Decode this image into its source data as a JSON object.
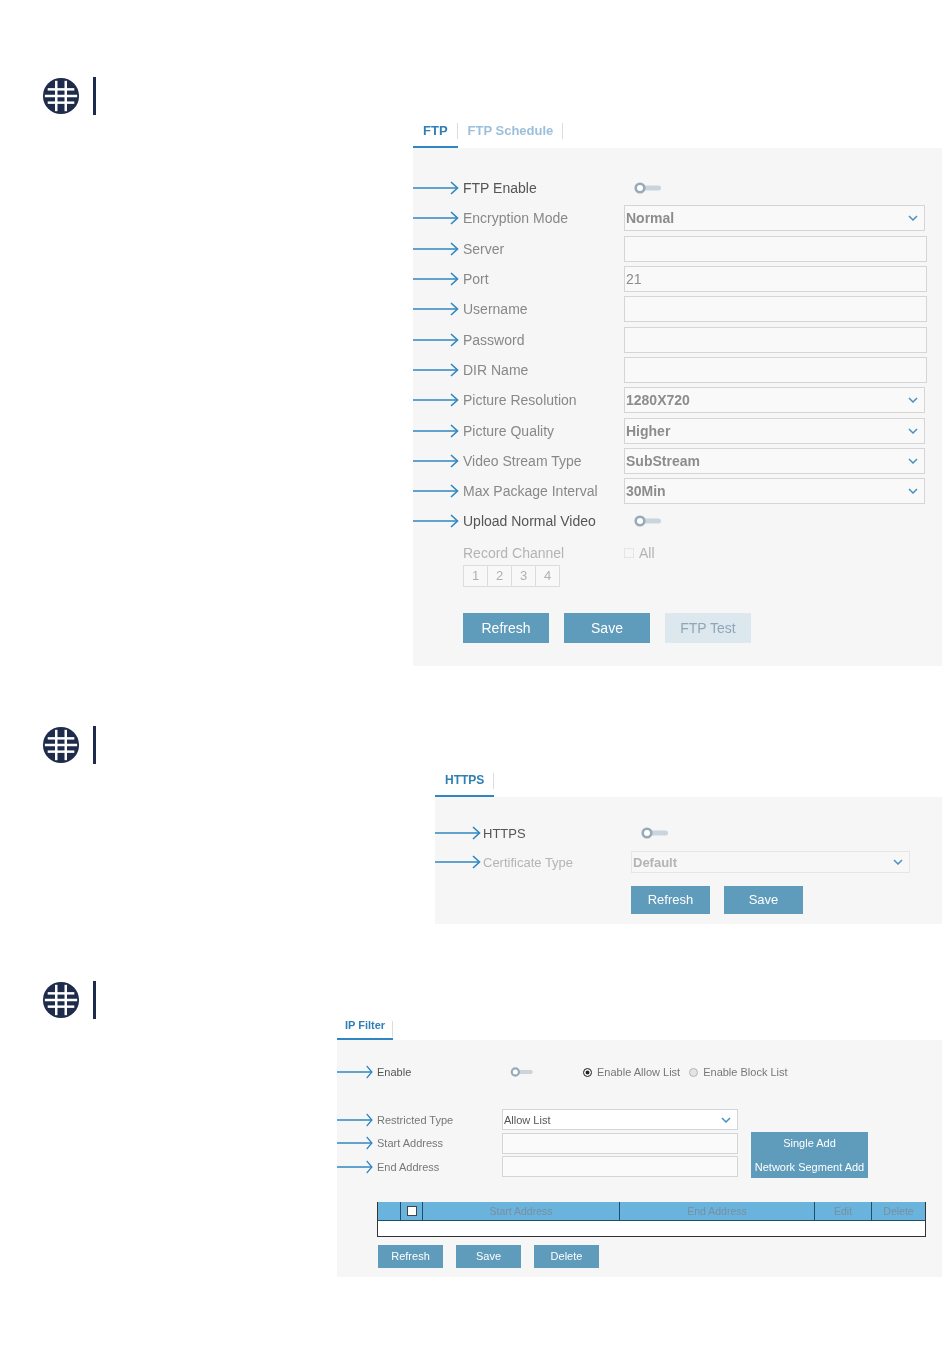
{
  "sections": [
    {
      "tabs": [
        {
          "label": "FTP",
          "selected": true
        },
        {
          "label": "FTP Schedule",
          "selected": false
        }
      ],
      "rows": [
        {
          "kind": "toggle",
          "label": "FTP Enable",
          "arrow": true,
          "disabled": false,
          "on": false
        },
        {
          "kind": "select",
          "label": "Encryption Mode",
          "arrow": true,
          "disabled": false,
          "value": "Normal"
        },
        {
          "kind": "input",
          "label": "Server",
          "arrow": true,
          "disabled": false
        },
        {
          "kind": "input",
          "label": "Port",
          "arrow": true,
          "disabled": false,
          "value": "21"
        },
        {
          "kind": "input",
          "label": "Username",
          "arrow": true,
          "disabled": false
        },
        {
          "kind": "input",
          "label": "Password",
          "arrow": true,
          "disabled": false
        },
        {
          "kind": "input",
          "label": "DIR Name",
          "arrow": true,
          "disabled": false
        },
        {
          "kind": "select",
          "label": "Picture Resolution",
          "arrow": true,
          "disabled": false,
          "value": "1280X720"
        },
        {
          "kind": "select",
          "label": "Picture Quality",
          "arrow": true,
          "disabled": false,
          "value": "Higher"
        },
        {
          "kind": "select",
          "label": "Video Stream Type",
          "arrow": true,
          "disabled": false,
          "value": "SubStream"
        },
        {
          "kind": "select",
          "label": "Max Package Interval",
          "arrow": true,
          "disabled": false,
          "value": "30Min"
        },
        {
          "kind": "toggle",
          "label": "Upload Normal Video",
          "arrow": true,
          "disabled": false,
          "on": false
        },
        {
          "kind": "channels",
          "label": "Record Channel",
          "arrow": false,
          "disabled": true,
          "checkbox_label": "All",
          "checked": false,
          "channels": [
            "1",
            "2",
            "3",
            "4"
          ]
        }
      ],
      "buttons": [
        {
          "label": "Refresh",
          "disabled": false
        },
        {
          "label": "Save",
          "disabled": false
        },
        {
          "label": "FTP Test",
          "disabled": true
        }
      ]
    },
    {
      "tabs": [
        {
          "label": "HTTPS",
          "selected": true
        }
      ],
      "rows": [
        {
          "kind": "toggle",
          "label": "HTTPS",
          "arrow": true,
          "disabled": false,
          "on": false
        },
        {
          "kind": "select",
          "label": "Certificate Type",
          "arrow": true,
          "disabled": true,
          "value": "Default"
        }
      ],
      "buttons": [
        {
          "label": "Refresh",
          "disabled": false
        },
        {
          "label": "Save",
          "disabled": false
        }
      ]
    },
    {
      "tabs": [
        {
          "label": "IP Filter",
          "selected": true
        }
      ],
      "rows": [
        {
          "kind": "toggle",
          "label": "Enable",
          "arrow": true,
          "disabled": false,
          "on": false,
          "options": [
            {
              "label": "Enable Allow List",
              "selected": true
            },
            {
              "label": "Enable Block List",
              "selected": false
            }
          ]
        },
        {
          "kind": "select",
          "label": "Restricted Type",
          "arrow": true,
          "disabled": false,
          "value": "Allow List"
        },
        {
          "kind": "input",
          "label": "Start Address",
          "arrow": true,
          "disabled": false,
          "action": "Single Add"
        },
        {
          "kind": "input",
          "label": "End Address",
          "arrow": true,
          "disabled": false,
          "action": "Network Segment Add"
        }
      ],
      "table": {
        "select_all": false,
        "columns": [
          "Start Address",
          "End Address",
          "Edit",
          "Delete"
        ]
      },
      "buttons": [
        {
          "label": "Refresh",
          "disabled": false
        },
        {
          "label": "Save",
          "disabled": false
        },
        {
          "label": "Delete",
          "disabled": false
        }
      ]
    }
  ]
}
